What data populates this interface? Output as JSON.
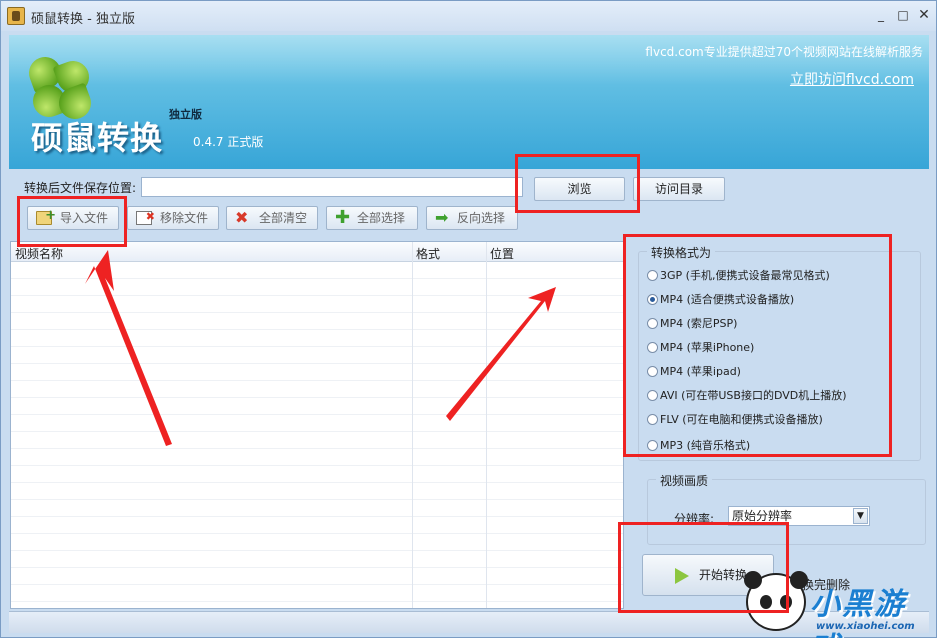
{
  "window": {
    "title": "硕鼠转换 - 独立版",
    "controls": {
      "minimize": "_",
      "maximize": "□",
      "close": "✕"
    }
  },
  "banner": {
    "brand": "硕鼠转换",
    "edition": "独立版",
    "version": "0.4.7  正式版",
    "promo": "flvcd.com专业提供超过70个视频网站在线解析服务",
    "visit_link": "立即访问flvcd.com"
  },
  "path": {
    "label": "转换后文件保存位置:",
    "value": "",
    "browse_label": "浏览",
    "visit_dir_label": "访问目录"
  },
  "toolbar": {
    "import": "导入文件",
    "remove": "移除文件",
    "clear_all": "全部清空",
    "select_all": "全部选择",
    "invert": "反向选择"
  },
  "file_list": {
    "columns": [
      "视频名称",
      "格式",
      "位置"
    ],
    "rows": []
  },
  "format_group": {
    "title": "转换格式为",
    "selected_index": 1,
    "options": [
      "3GP (手机,便携式设备最常见格式)",
      "MP4 (适合便携式设备播放)",
      "MP4 (索尼PSP)",
      "MP4 (苹果iPhone)",
      "MP4 (苹果ipad)",
      "AVI  (可在带USB接口的DVD机上播放)",
      "FLV  (可在电脑和便携式设备播放)",
      "MP3 (纯音乐格式)"
    ]
  },
  "quality": {
    "title": "视频画质",
    "resolution_label": "分辨率:",
    "resolution_value": "原始分辨率"
  },
  "start": {
    "label": "开始转换",
    "after_label": "转换完删除"
  },
  "watermark": {
    "title": "小黑游戏",
    "url": "www.xiaohei.com"
  },
  "colors": {
    "banner_top": "#79cdea",
    "banner_bottom": "#37a5d7",
    "annotation": "#ee2222",
    "window_bg": "#c9dcf0"
  }
}
